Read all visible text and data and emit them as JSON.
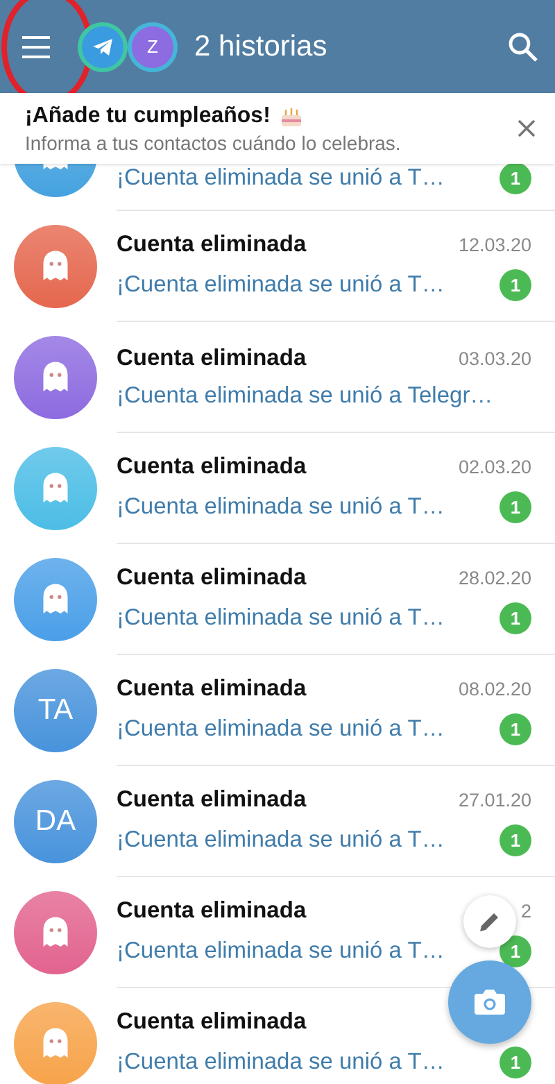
{
  "header": {
    "title": "2 historias",
    "stories": [
      {
        "kind": "logo",
        "color": "#3a9be0"
      },
      {
        "kind": "initial",
        "text": "Z",
        "color": "#8d6be0"
      }
    ]
  },
  "banner": {
    "title": "¡Añade tu cumpleaños!",
    "subtitle": "Informa a tus contactos cuándo lo celebras."
  },
  "chats": [
    {
      "avatar": {
        "kind": "ghost",
        "color": "#45a2df"
      },
      "preview": "¡Cuenta eliminada se unió a T…",
      "unread": "1"
    },
    {
      "avatar": {
        "kind": "ghost",
        "color": "#e5674e"
      },
      "name": "Cuenta eliminada",
      "date": "12.03.20",
      "preview": "¡Cuenta eliminada se unió a T…",
      "unread": "1"
    },
    {
      "avatar": {
        "kind": "ghost",
        "color": "#8d6be0"
      },
      "name": "Cuenta eliminada",
      "date": "03.03.20",
      "preview": "¡Cuenta eliminada se unió a Telegr…"
    },
    {
      "avatar": {
        "kind": "ghost",
        "color": "#4cbde6"
      },
      "name": "Cuenta eliminada",
      "date": "02.03.20",
      "preview": "¡Cuenta eliminada se unió a T…",
      "unread": "1"
    },
    {
      "avatar": {
        "kind": "ghost",
        "color": "#4a9fe8"
      },
      "name": "Cuenta eliminada",
      "date": "28.02.20",
      "preview": "¡Cuenta eliminada se unió a T…",
      "unread": "1"
    },
    {
      "avatar": {
        "kind": "initials",
        "text": "TA",
        "color": "#4893dc"
      },
      "name": "Cuenta eliminada",
      "date": "08.02.20",
      "preview": "¡Cuenta eliminada se unió a T…",
      "unread": "1"
    },
    {
      "avatar": {
        "kind": "initials",
        "text": "DA",
        "color": "#4893dc"
      },
      "name": "Cuenta eliminada",
      "date": "27.01.20",
      "preview": "¡Cuenta eliminada se unió a T…",
      "unread": "1"
    },
    {
      "avatar": {
        "kind": "ghost",
        "color": "#e2638f"
      },
      "name": "Cuenta eliminada",
      "date": "2",
      "preview": "¡Cuenta eliminada se unió a T…",
      "unread": "1"
    },
    {
      "avatar": {
        "kind": "ghost",
        "color": "#f7a34a"
      },
      "name": "Cuenta eliminada",
      "preview": "¡Cuenta eliminada se unió a T…",
      "unread": "1"
    }
  ]
}
